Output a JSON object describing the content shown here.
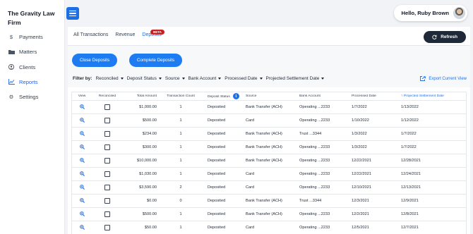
{
  "sidebar": {
    "brand_line1": "The Gravity Law",
    "brand_line2": "Firm",
    "items": [
      {
        "label": "Payments",
        "icon": "dollar-icon"
      },
      {
        "label": "Matters",
        "icon": "folder-icon"
      },
      {
        "label": "Clients",
        "icon": "user-circle-icon"
      },
      {
        "label": "Reports",
        "icon": "chart-icon",
        "active": true
      },
      {
        "label": "Settings",
        "icon": "gear-icon"
      }
    ]
  },
  "header": {
    "user_greeting": "Hello, Ruby Brown"
  },
  "tabs": [
    {
      "label": "All Transactions"
    },
    {
      "label": "Revenue"
    },
    {
      "label": "Deposits",
      "active": true
    }
  ],
  "beta_label": "BETA",
  "refresh_label": "Refresh",
  "actions": {
    "close_deposits": "Close Deposits",
    "complete_deposits": "Complete Deposits"
  },
  "filters": {
    "label": "Filter by:",
    "items": [
      "Reconciled",
      "Deposit Status",
      "Source",
      "Bank Account",
      "Processed Date",
      "Projected Settlement Date"
    ]
  },
  "export_label": "Export Current View",
  "table": {
    "columns": [
      "View",
      "Reconciled",
      "Total Amount",
      "Transaction Count",
      "Deposit Status",
      "Source",
      "Bank Account",
      "Processed Date",
      "Projected Settlement Date"
    ],
    "rows": [
      {
        "amount": "$1,000.00",
        "count": "1",
        "status": "Deposited",
        "source": "Bank Transfer (ACH)",
        "account": "Operating ...2233",
        "processed": "1/7/2022",
        "projected": "1/13/2022"
      },
      {
        "amount": "$500.00",
        "count": "1",
        "status": "Deposited",
        "source": "Card",
        "account": "Operating ...2233",
        "processed": "1/10/2022",
        "projected": "1/12/2022"
      },
      {
        "amount": "$234.00",
        "count": "1",
        "status": "Deposited",
        "source": "Bank Transfer (ACH)",
        "account": "Trust ...3344",
        "processed": "1/3/2022",
        "projected": "1/7/2022"
      },
      {
        "amount": "$300.00",
        "count": "1",
        "status": "Deposited",
        "source": "Bank Transfer (ACH)",
        "account": "Operating ...2233",
        "processed": "1/3/2022",
        "projected": "1/7/2022"
      },
      {
        "amount": "$10,000.00",
        "count": "1",
        "status": "Deposited",
        "source": "Bank Transfer (ACH)",
        "account": "Operating ...2233",
        "processed": "12/22/2021",
        "projected": "12/28/2021"
      },
      {
        "amount": "$1,030.00",
        "count": "1",
        "status": "Deposited",
        "source": "Card",
        "account": "Operating ...2233",
        "processed": "12/22/2021",
        "projected": "12/24/2021"
      },
      {
        "amount": "$3,590.00",
        "count": "2",
        "status": "Deposited",
        "source": "Card",
        "account": "Operating ...2233",
        "processed": "12/10/2021",
        "projected": "12/13/2021"
      },
      {
        "amount": "$0.00",
        "count": "0",
        "status": "Deposited",
        "source": "Bank Transfer (ACH)",
        "account": "Trust ...3344",
        "processed": "12/3/2021",
        "projected": "12/9/2021"
      },
      {
        "amount": "$500.00",
        "count": "1",
        "status": "Deposited",
        "source": "Bank Transfer (ACH)",
        "account": "Operating ...2233",
        "processed": "12/2/2021",
        "projected": "12/8/2021"
      },
      {
        "amount": "$50.00",
        "count": "1",
        "status": "Deposited",
        "source": "Card",
        "account": "Operating ...2233",
        "processed": "12/5/2021",
        "projected": "12/7/2021"
      }
    ]
  },
  "colors": {
    "accent": "#1d6fe6",
    "button": "#1d7cf2",
    "dark_button": "#1f2937",
    "beta": "#c81e1e"
  }
}
